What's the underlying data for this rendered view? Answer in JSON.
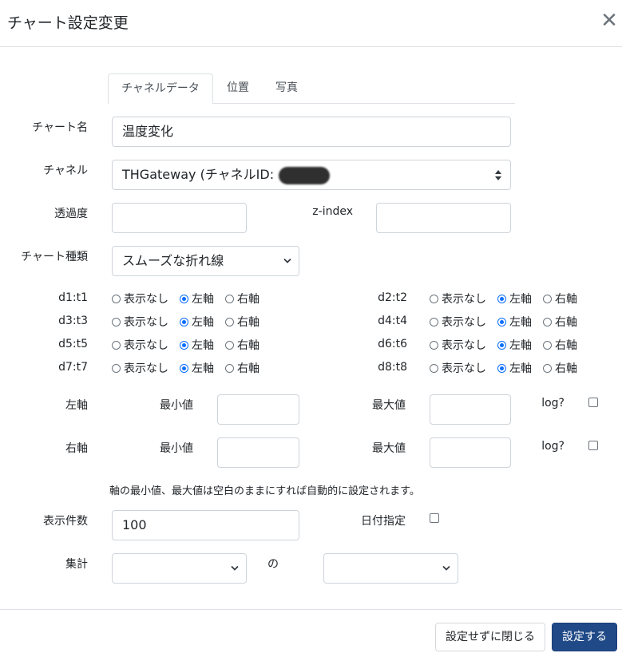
{
  "modal": {
    "title": "チャート設定変更",
    "close_glyph": "✕"
  },
  "tabs": [
    {
      "label": "チャネルデータ",
      "active": true
    },
    {
      "label": "位置",
      "active": false
    },
    {
      "label": "写真",
      "active": false
    }
  ],
  "form": {
    "chart_name": {
      "label": "チャート名",
      "value": "温度変化"
    },
    "channel": {
      "label": "チャネル",
      "value": "THGateway (チャネルID:"
    },
    "opacity": {
      "label": "透過度",
      "value": ""
    },
    "zindex": {
      "label": "z-index",
      "value": ""
    },
    "chart_type": {
      "label": "チャート種類",
      "value": "スムーズな折れ線"
    },
    "radio_options": [
      "表示なし",
      "左軸",
      "右軸"
    ],
    "channels": [
      {
        "label": "d1:t1",
        "selected": 1
      },
      {
        "label": "d2:t2",
        "selected": 1
      },
      {
        "label": "d3:t3",
        "selected": 1
      },
      {
        "label": "d4:t4",
        "selected": 1
      },
      {
        "label": "d5:t5",
        "selected": 1
      },
      {
        "label": "d6:t6",
        "selected": 1
      },
      {
        "label": "d7:t7",
        "selected": 1
      },
      {
        "label": "d8:t8",
        "selected": 1
      }
    ],
    "left_axis": {
      "label": "左軸",
      "min_label": "最小値",
      "max_label": "最大値",
      "log_label": "log?",
      "min": "",
      "max": "",
      "log": false
    },
    "right_axis": {
      "label": "右軸",
      "min_label": "最小値",
      "max_label": "最大値",
      "log_label": "log?",
      "min": "",
      "max": "",
      "log": false
    },
    "axis_note": "軸の最小値、最大値は空白のままにすれば自動的に設定されます。",
    "count": {
      "label": "表示件数",
      "value": "100"
    },
    "date_spec": {
      "label": "日付指定",
      "checked": false
    },
    "aggregate": {
      "label": "集計",
      "of_label": "の",
      "value1": "",
      "value2": ""
    }
  },
  "footer": {
    "close_label": "設定せずに閉じる",
    "apply_label": "設定する"
  }
}
